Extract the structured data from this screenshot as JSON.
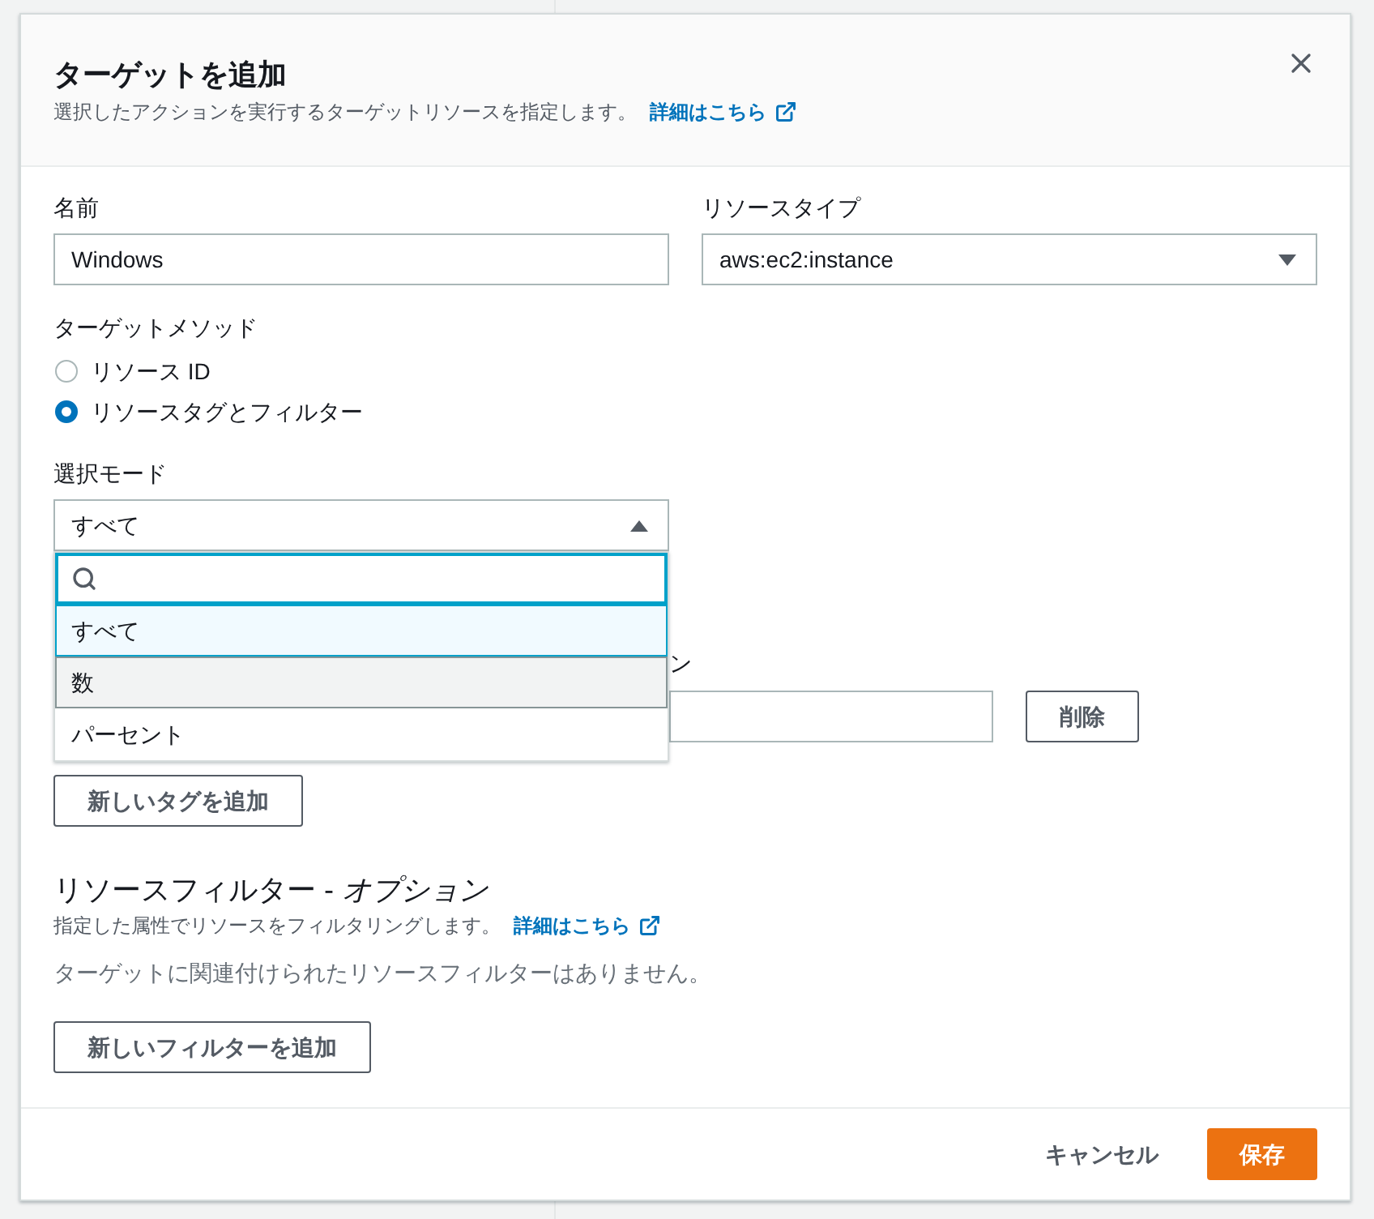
{
  "dialog": {
    "title": "ターゲットを追加",
    "description": "選択したアクションを実行するターゲットリソースを指定します。",
    "learn_more_link": "詳細はこちら"
  },
  "form": {
    "name": {
      "label": "名前",
      "value": "Windows"
    },
    "resource_type": {
      "label": "リソースタイプ",
      "value": "aws:ec2:instance"
    },
    "target_method": {
      "label": "ターゲットメソッド",
      "options": [
        {
          "label": "リソース ID",
          "selected": false
        },
        {
          "label": "リソースタグとフィルター",
          "selected": true
        }
      ]
    },
    "selection_mode": {
      "label": "選択モード",
      "value": "すべて",
      "expanded": true,
      "options": [
        {
          "label": "すべて",
          "selected": true,
          "highlighted": false
        },
        {
          "label": "数",
          "selected": false,
          "highlighted": true
        },
        {
          "label": "パーセント",
          "selected": false,
          "highlighted": false
        }
      ]
    },
    "resource_tags": {
      "column_2_label": "ン",
      "delete_button": "削除",
      "add_button": "新しいタグを追加"
    },
    "resource_filters": {
      "title": "リソースフィルター - *オプション*",
      "description": "指定した属性でリソースをフィルタリングします。",
      "learn_more_link": "詳細はこちら",
      "empty_message": "ターゲットに関連付けられたリソースフィルターはありません。",
      "add_button": "新しいフィルターを追加"
    }
  },
  "footer": {
    "buttons": [
      {
        "label": "キャンセル",
        "kind": "link"
      },
      {
        "label": "保存",
        "kind": "primary"
      }
    ]
  }
}
